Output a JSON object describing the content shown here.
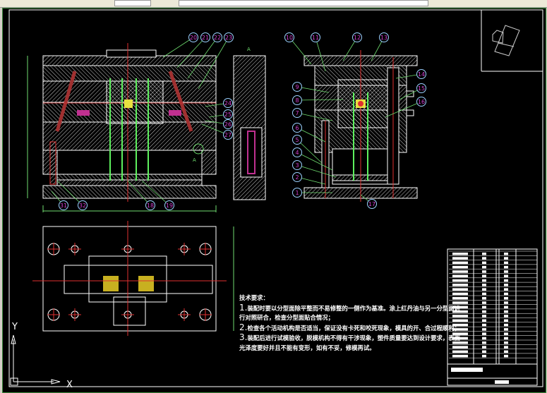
{
  "tech_requirements": {
    "title": "技术要求：",
    "items": [
      {
        "num": "1.",
        "lines": [
          "装配时要以分型面除平整而不易修整的一侧作为基准。涂上红丹油与另一分型面进",
          "行对照研合，检查分型面贴合情况；"
        ]
      },
      {
        "num": "2.",
        "lines": [
          "检查各个活动机构是否适当，保证没有卡死和咬死现象，模具的开、合过程顺利；"
        ]
      },
      {
        "num": "3.",
        "lines": [
          "装配后进行试模验收，脱模机构不得有干涉现象，塑件质量要达到设计要求，表面",
          "光泽度要好并且不能有变形，如有不妥，修模再试。"
        ]
      }
    ]
  },
  "balloons": [
    "20",
    "21",
    "22",
    "23",
    "10",
    "11",
    "12",
    "13",
    "14",
    "15",
    "16",
    "9",
    "8",
    "7",
    "6",
    "5",
    "4",
    "3",
    "2",
    "1",
    "17",
    "24",
    "25",
    "26",
    "27",
    "31",
    "32",
    "18",
    "19"
  ],
  "section_labels": {
    "a_top": "A",
    "a_bottom": "A"
  },
  "ucs": {
    "x_label": "X",
    "y_label": "Y"
  },
  "colors": {
    "background": "#000000",
    "outline": "#ffffff",
    "leader": "#6fdc6f",
    "balloon": "#9ad0ff",
    "balloon_text": "#d040d0",
    "centerline": "#e03030",
    "pin": "#5ef05e",
    "gate": "#e8e040"
  }
}
